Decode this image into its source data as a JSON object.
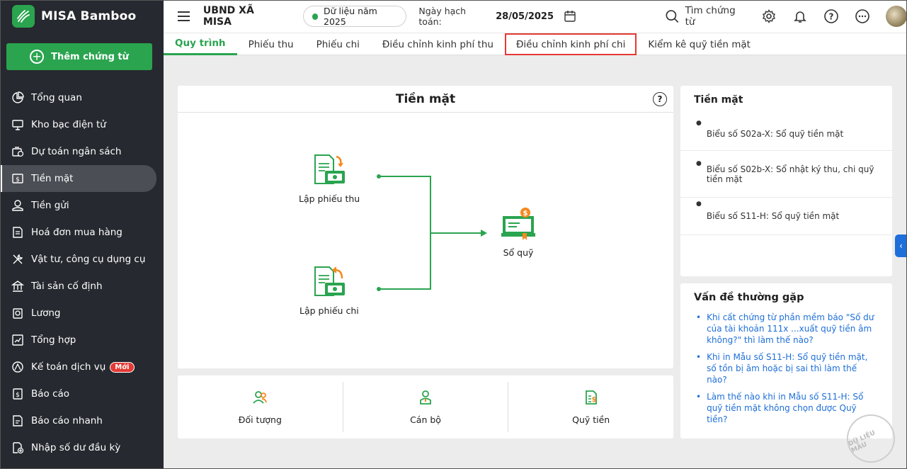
{
  "app": {
    "name": "MISA Bamboo"
  },
  "sidebar": {
    "add_button": "Thêm chứng từ",
    "items": [
      {
        "label": "Tổng quan",
        "icon": "pie-chart-icon"
      },
      {
        "label": "Kho bạc điện tử",
        "icon": "monitor-icon"
      },
      {
        "label": "Dự toán ngân sách",
        "icon": "budget-icon"
      },
      {
        "label": "Tiền mặt",
        "icon": "cash-icon"
      },
      {
        "label": "Tiền gửi",
        "icon": "deposit-icon"
      },
      {
        "label": "Hoá đơn mua hàng",
        "icon": "invoice-icon"
      },
      {
        "label": "Vật tư, công cụ dụng cụ",
        "icon": "tools-icon"
      },
      {
        "label": "Tài sản cố định",
        "icon": "building-icon"
      },
      {
        "label": "Lương",
        "icon": "salary-icon"
      },
      {
        "label": "Tổng hợp",
        "icon": "summary-icon"
      },
      {
        "label": "Kế toán dịch vụ",
        "icon": "service-icon",
        "badge": "Mới"
      },
      {
        "label": "Báo cáo",
        "icon": "report-icon"
      },
      {
        "label": "Báo cáo nhanh",
        "icon": "quick-report-icon"
      },
      {
        "label": "Nhập số dư đầu kỳ",
        "icon": "opening-balance-icon"
      }
    ]
  },
  "topbar": {
    "org": "UBND XÃ MISA",
    "year": "Dữ liệu năm 2025",
    "accounting_date_label": "Ngày hạch toán:",
    "accounting_date": "28/05/2025",
    "search": "Tìm chứng từ"
  },
  "tabs": [
    {
      "label": "Quy trình"
    },
    {
      "label": "Phiếu thu"
    },
    {
      "label": "Phiếu chi"
    },
    {
      "label": "Điều chỉnh kinh phí thu"
    },
    {
      "label": "Điều chỉnh kinh phí chi"
    },
    {
      "label": "Kiểm kê quỹ tiền mặt"
    }
  ],
  "main": {
    "title": "Tiền mặt",
    "help": "?",
    "flow": {
      "receipt": "Lập phiếu thu",
      "payment": "Lập phiếu chi",
      "ledger": "Sổ quỹ"
    },
    "bottom": [
      {
        "label": "Đối tượng"
      },
      {
        "label": "Cán bộ"
      },
      {
        "label": "Quỹ tiền"
      }
    ]
  },
  "reports": {
    "title": "Tiền mặt",
    "items": [
      "Biểu số S02a-X: Sổ quỹ tiền mặt",
      "Biểu số S02b-X: Sổ nhật ký thu, chi quỹ tiền mặt",
      "Biểu số S11-H: Sổ quỹ tiền mặt"
    ]
  },
  "faq": {
    "title": "Vấn đề thường gặp",
    "items": [
      "Khi cất chứng từ phần mềm báo \"Số dư của tài khoản 111x ...xuất quỹ tiền âm không?\" thì làm thế nào?",
      "Khi in Mẫu số S11-H: Sổ quỹ tiền mặt, số tồn bị âm hoặc bị sai thì làm thế nào?",
      "Làm thế nào khi in Mẫu số S11-H: Sổ quỹ tiền mặt không chọn được Quỹ tiền?"
    ]
  },
  "watermark": "DỮ LIỆU MẪU",
  "colors": {
    "brand": "#2aa44f",
    "sidebar": "#26292f",
    "link": "#1e6fd9",
    "highlight": "#e53935",
    "accent_orange": "#f5891f"
  }
}
